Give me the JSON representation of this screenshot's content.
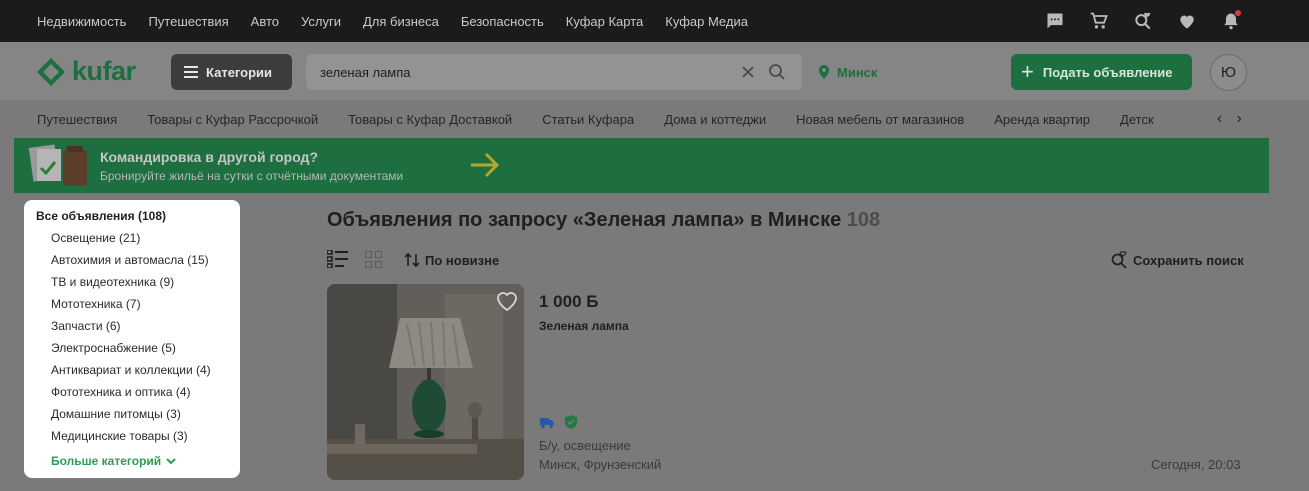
{
  "top_nav": [
    "Недвижимость",
    "Путешествия",
    "Авто",
    "Услуги",
    "Для бизнеса",
    "Безопасность",
    "Куфар Карта",
    "Куфар Медиа"
  ],
  "top_icons": [
    "chat-icon",
    "cart-icon",
    "saved-search-icon",
    "heart-icon",
    "bell-icon"
  ],
  "header": {
    "logo_text": "kufar",
    "categories_label": "Категории",
    "search_value": "зеленая лампа",
    "city": "Минск",
    "post_ad_label": "Подать объявление",
    "avatar_letter": "Ю"
  },
  "subnav": [
    "Путешествия",
    "Товары с Куфар Рассрочкой",
    "Товары с Куфар Доставкой",
    "Статьи Куфара",
    "Дома и коттеджи",
    "Новая мебель от магазинов",
    "Аренда квартир",
    "Детск"
  ],
  "banner": {
    "title": "Командировка в другой город?",
    "subtitle": "Бронируйте жильё на сутки с отчётными документами"
  },
  "sidebar": {
    "all": "Все объявления (108)",
    "categories": [
      "Освещение (21)",
      "Автохимия и автомасла (15)",
      "ТВ и видеотехника (9)",
      "Мототехника (7)",
      "Запчасти (6)",
      "Электроснабжение (5)",
      "Антиквариат и коллекции (4)",
      "Фототехника и оптика (4)",
      "Домашние питомцы (3)",
      "Медицинские товары (3)"
    ],
    "more_label": "Больше категорий"
  },
  "results": {
    "title": "Объявления по запросу «Зеленая лампа» в Минске",
    "count": "108",
    "sort_label": "По новизне",
    "save_search_label": "Сохранить поиск"
  },
  "listing": {
    "price": "1 000 Б",
    "title": "Зеленая лампа",
    "condition": "Б/у, освещение",
    "location": "Минск, Фрунзенский",
    "time": "Сегодня, 20:03"
  },
  "colors": {
    "brand_green": "#2d9d54",
    "topbar": "#1b1b1b",
    "overlay": "#7a7a7a"
  }
}
